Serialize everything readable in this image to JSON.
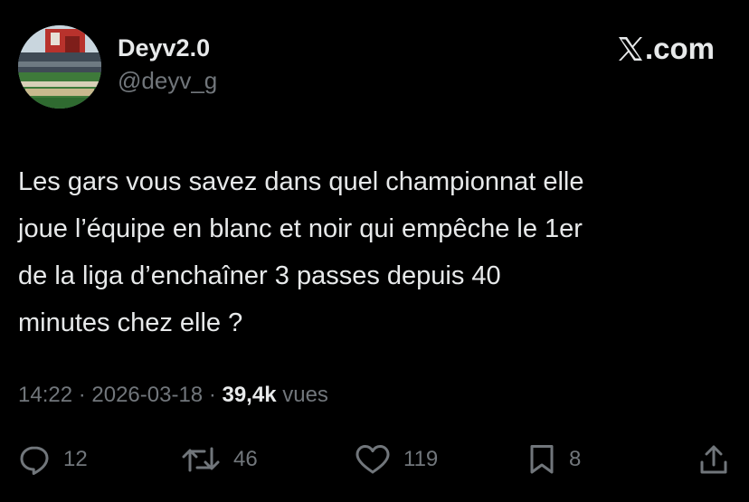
{
  "author": {
    "display_name": "Deyv2.0",
    "handle": "@deyv_g",
    "avatar_icon": "stadium-photo-avatar"
  },
  "brand": {
    "icon": "x-logo-icon",
    "text": ".com"
  },
  "tweet": {
    "text": "Les gars vous savez dans quel championnat elle\njoue l’équipe en blanc et noir qui empêche le 1er\nde la liga d’enchaîner 3 passes depuis 40\nminutes chez elle ?"
  },
  "meta": {
    "time": "14:22",
    "separator": " · ",
    "date": "2026-03-18",
    "views_count": "39,4k",
    "views_label": " vues"
  },
  "actions": {
    "reply": {
      "icon": "reply-icon",
      "count": "12"
    },
    "repost": {
      "icon": "repost-icon",
      "count": "46"
    },
    "like": {
      "icon": "heart-icon",
      "count": "119"
    },
    "bookmark": {
      "icon": "bookmark-icon",
      "count": "8"
    },
    "share": {
      "icon": "share-icon"
    }
  },
  "colors": {
    "background": "#000000",
    "text_primary": "#e7e9ea",
    "text_secondary": "#71767b"
  }
}
